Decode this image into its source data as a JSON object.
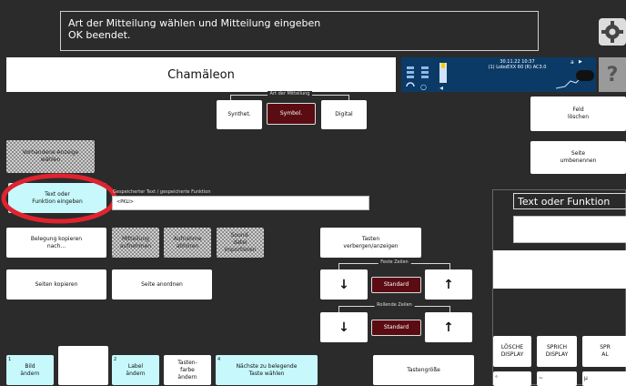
{
  "message": {
    "line1": "Art der Mitteilung wählen und Mitteilung eingeben",
    "line2": "OK beendet."
  },
  "title": "Chamäleon",
  "status": {
    "datetime": "30.11.22 10:37",
    "device": "(1) LoboEXX 60 (R) AC3.0",
    "a_label": "a",
    "arrow": "▶"
  },
  "help_symbol": "?",
  "mitteilung": {
    "legend": "Art der Mitteilung",
    "options": [
      "Synthet.",
      "Symbol.",
      "Digital"
    ],
    "selected": "Symbol."
  },
  "right_buttons": {
    "clear": "Feld\nlöschen",
    "page": "Seite\numbenennen"
  },
  "vorhandene_anzeigen": "Vorhandene Anzeige\nwählen",
  "text_function": "Text oder\nFunktion eingeben",
  "stored_label": "Gespeicherter Text / gespeicherte Funktion",
  "stored_value": "<PKLI>",
  "row_copy": {
    "belegung": "Belegung kopieren\nnach...",
    "mitteilung": "Mitteilung\naufnehmen",
    "aufnahme": "Aufnahme\nabhören",
    "sound": "Sound-\ndatei\nimportieren"
  },
  "tasten": "Tasten\nverbergen/anzeigen",
  "seiten_kopieren": "Seiten kopieren",
  "seite_anordnen": "Seite anordnen",
  "feste_zeilen": {
    "legend": "Feste Zeilen",
    "value": "Standard"
  },
  "rollende_zeilen": {
    "legend": "Rollende Zeilen",
    "value": "Standard"
  },
  "arrows": {
    "down": "↓",
    "up": "↑"
  },
  "bottom": {
    "bild": {
      "num": "1",
      "label": "Bild\nändern"
    },
    "label": {
      "num": "2",
      "label": "Label\nändern"
    },
    "farbe": {
      "label": "Tasten-\nfarbe\nändern"
    },
    "naechste": {
      "num": "4",
      "label": "Nächste zu belegende\nTaste wählen"
    },
    "groesse": {
      "label": "Tastengröße"
    }
  },
  "right_panel": {
    "title": "Text oder Funktion",
    "loesche": "LÖSCHE\nDISPLAY",
    "sprich": "SPRICH\nDISPLAY",
    "spr": "SPR\nAL",
    "small1": "°",
    "small2": "~",
    "small3": "µ"
  }
}
